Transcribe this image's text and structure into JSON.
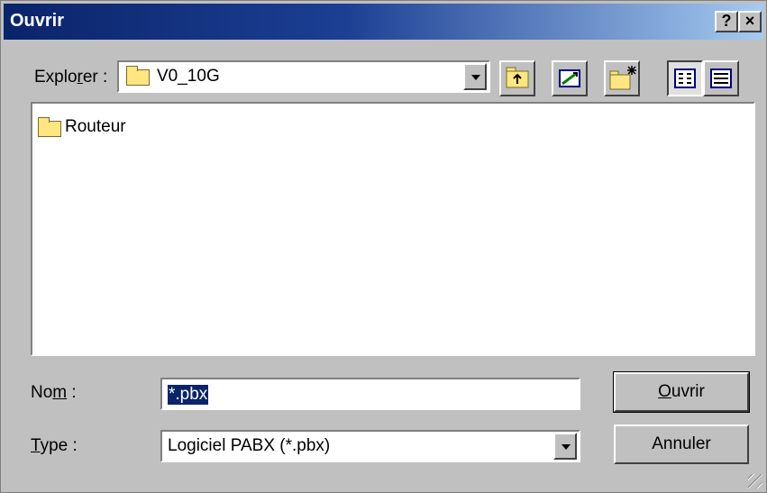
{
  "window": {
    "title": "Ouvrir",
    "help_button": "?",
    "close_button": "×"
  },
  "location": {
    "label_prefix": "Explo",
    "label_accel": "r",
    "label_suffix": "er :",
    "current_folder": "V0_10G"
  },
  "toolbar": {
    "buttons": [
      "up-one-level",
      "go-to-desktop",
      "create-new-folder",
      "list-view",
      "details-view"
    ]
  },
  "file_list": {
    "items": [
      {
        "type": "folder",
        "name": "Routeur"
      }
    ]
  },
  "filename": {
    "label_prefix": "No",
    "label_accel": "m",
    "label_suffix": " :",
    "value": "*.pbx"
  },
  "filetype": {
    "label_accel": "T",
    "label_suffix": "ype :",
    "value": "Logiciel PABX (*.pbx)"
  },
  "buttons": {
    "open_accel": "O",
    "open_rest": "uvrir",
    "cancel": "Annuler"
  }
}
